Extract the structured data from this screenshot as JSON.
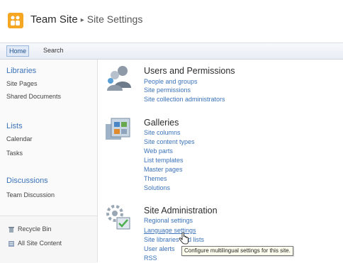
{
  "header": {
    "site_title": "Team Site",
    "separator": "▸",
    "page_title": "Site Settings"
  },
  "topnav": {
    "home": "Home",
    "search": "Search"
  },
  "leftnav": {
    "libraries": {
      "heading": "Libraries",
      "items": [
        "Site Pages",
        "Shared Documents"
      ]
    },
    "lists": {
      "heading": "Lists",
      "items": [
        "Calendar",
        "Tasks"
      ]
    },
    "discussions": {
      "heading": "Discussions",
      "items": [
        "Team Discussion"
      ]
    },
    "recycle_bin": "Recycle Bin",
    "all_site_content": "All Site Content"
  },
  "main": {
    "users": {
      "heading": "Users and Permissions",
      "links": [
        "People and groups",
        "Site permissions",
        "Site collection administrators"
      ]
    },
    "galleries": {
      "heading": "Galleries",
      "links": [
        "Site columns",
        "Site content types",
        "Web parts",
        "List templates",
        "Master pages",
        "Themes",
        "Solutions"
      ]
    },
    "admin": {
      "heading": "Site Administration",
      "links": [
        "Regional settings",
        "Language settings",
        "Site libraries and lists",
        "User alerts",
        "RSS"
      ]
    }
  },
  "tooltip": "Configure multilingual settings for this site.",
  "colors": {
    "link": "#3b73b9",
    "logo": "#f5a623",
    "nav_bg": "#fafafa"
  }
}
